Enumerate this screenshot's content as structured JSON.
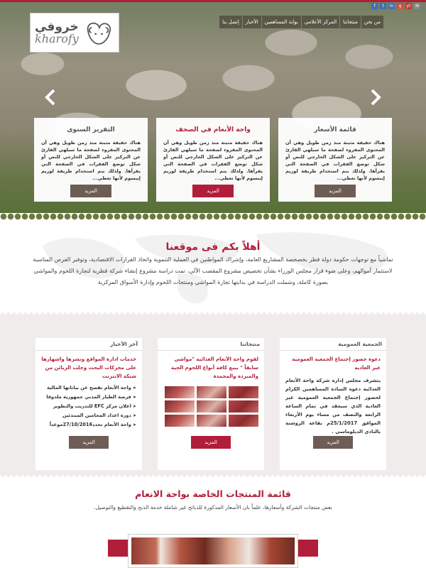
{
  "social": [
    "f",
    "t",
    "in",
    "g",
    "yt",
    "✉"
  ],
  "brand": {
    "name_ar": "خروفي",
    "name_en": "kharofy"
  },
  "nav": [
    "من نحن",
    "منتجاتنا",
    "المركز الأعلامي",
    "بوابة المساهمين",
    "الأخبار",
    "إتصل بنا"
  ],
  "cards": [
    {
      "title": "قائمة الأسعار",
      "text": "هناك حقيقة مثبتة منذ زمن طويل وهي أن المحتوى المقروء لصفحة ما سيلهي القارئ عن التركيز على الشكل الخارجي للنص أو شكل توضع الفقرات في الصفحة التي يقرأها. ولذلك يتم استخدام طريقة لوريم إيبسوم لأنها تعطي...",
      "button": "المزيد",
      "accent": false
    },
    {
      "title": "واحة الأنعام في الصحف",
      "text": "هناك حقيقة مثبتة منذ زمن طويل وهي أن المحتوى المقروء لصفحة ما سيلهي القارئ عن التركيز على الشكل الخارجي للنص أو شكل توضع الفقرات في الصفحة التي يقرأها. ولذلك يتم استخدام طريقة لوريم إيبسوم لأنها تعطي...",
      "button": "المزيد",
      "accent": true
    },
    {
      "title": "التقرير السنوى",
      "text": "هناك حقيقة مثبتة منذ زمن طويل وهي أن المحتوى المقروء لصفحة ما سيلهي القارئ عن التركيز على الشكل الخارجي للنص أو شكل توضع الفقرات في الصفحة التي يقرأها. ولذلك يتم استخدام طريقة لوريم إيبسوم لأنها تعطي...",
      "button": "المزيد",
      "accent": false
    }
  ],
  "welcome": {
    "title": "أهلاً بكم فى موقعنا",
    "text": "تماشياً مع توجهات حكومة دولة قطر بخصخصة المشاريع العامة، وإشراك المواطنين في العملية التنموية واتخاذ القرارات الاقتصادية، وتوفير الفرص المناسبة لاستثمار أموالهم، وعلى ضوء قرار مجلس الوزراء بشأن تخصيص مشروع المقصب الآلي، تمت دراسة مشروع إنشاء شركة قطرية لتجارة اللحوم والمواشي بصورة كاملة، وشملت الدراسة في بدايتها تجارة المواشي ومنتجات اللحوم وإدارة الأسواق المركزية"
  },
  "assembly": {
    "heading": "الجمعية العمومية",
    "link": "دعوة حضور إجتماع الجمعية العمومية غير العادية",
    "text": "يتشرف مجلس إدارة شركة واحة الأنعام الغذائية دعوة السادة المساهمين الكرام لحضور إجتماع الجمعية العمومية غير العادية الذي سيعقد في تمام الساعة الرابعة والنصف من مساء يوم الأربعاء الموافق 25/1/2017م بقاعة الروشنة بالنادي الدبلوماسي .",
    "button": "المزيد"
  },
  "products": {
    "heading": "منتجاتنا",
    "link": "لقوم واحة الأنعام الغذائية \"مواشي سابقاً \" يبيع كافة أنواع اللحوم الحية والمبرده والمجمدة",
    "button": "المزيد"
  },
  "news": {
    "heading": "آخر الأخبار",
    "link": "خدمات ادارة المواقع ونشرها واشهارها على محركات البحث وجلب الزبائن من شبكة الانترنت",
    "items": [
      "واحة الأنعام تفصح عن بياناتها المالية",
      "فرصة الطيار المدني جمهورية ملدوفا",
      "اعلان مركز EFC للتدريب والتطوير",
      "دورة اعداد المحامين المبتدئين",
      "واحة الأنعام تحدد27/10/2016موعداً"
    ],
    "button": "المزيد"
  },
  "prices_section": {
    "title": "قائمة المنتجات الخاصة بواحة الانعام",
    "text": "بعض منتجات الشركة وأسعارها، علماً بان الأسعار المذكورة للذبائح غير شاملة خدمة الذبح والتقطيع والتوصيل."
  },
  "colors": {
    "accent": "#b11e3a",
    "dark_button": "#6d5d55",
    "band": "#f0ecec"
  }
}
